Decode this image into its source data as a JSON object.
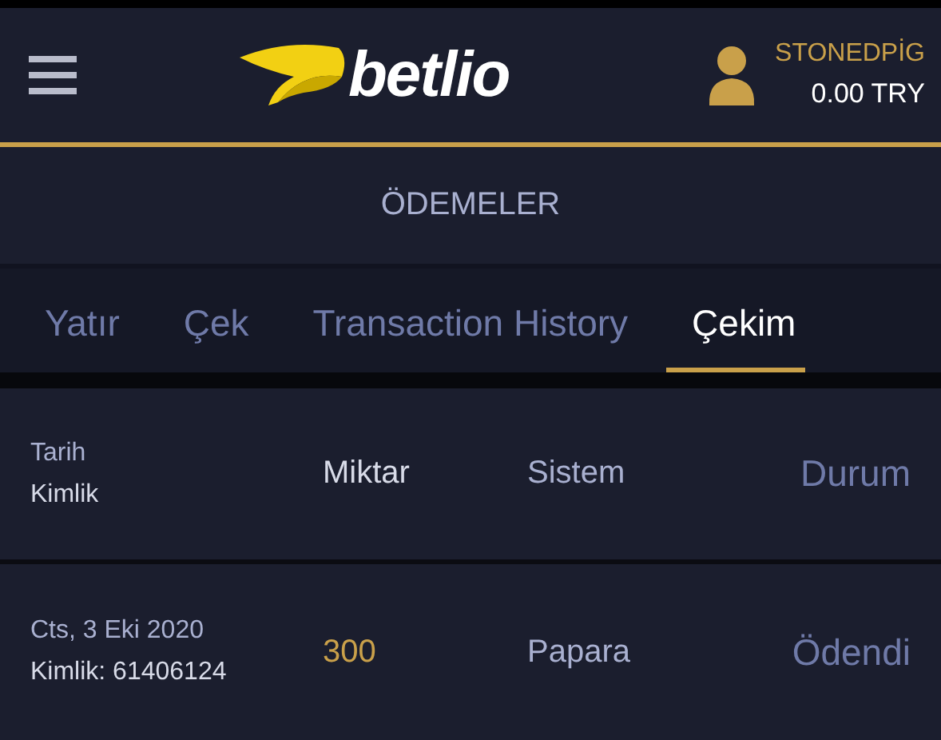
{
  "header": {
    "brand": "betlio",
    "user": {
      "name": "STONEDPİG",
      "balance": "0.00 TRY"
    }
  },
  "page_title": "ÖDEMELER",
  "tabs": [
    {
      "label": "Yatır",
      "selected": false
    },
    {
      "label": "Çek",
      "selected": false
    },
    {
      "label": "Transaction History",
      "selected": false
    },
    {
      "label": "Çekim",
      "selected": true
    }
  ],
  "table": {
    "columns": [
      [
        "Tarih",
        "Kimlik"
      ],
      [
        "Miktar"
      ],
      [
        "Sistem"
      ],
      [
        "Durum"
      ]
    ],
    "rows": [
      {
        "date": "Cts, 3 Eki 2020",
        "id": "Kimlik: 61406124",
        "amount": "300",
        "system": "Papara",
        "status": "Ödendi"
      }
    ]
  }
}
